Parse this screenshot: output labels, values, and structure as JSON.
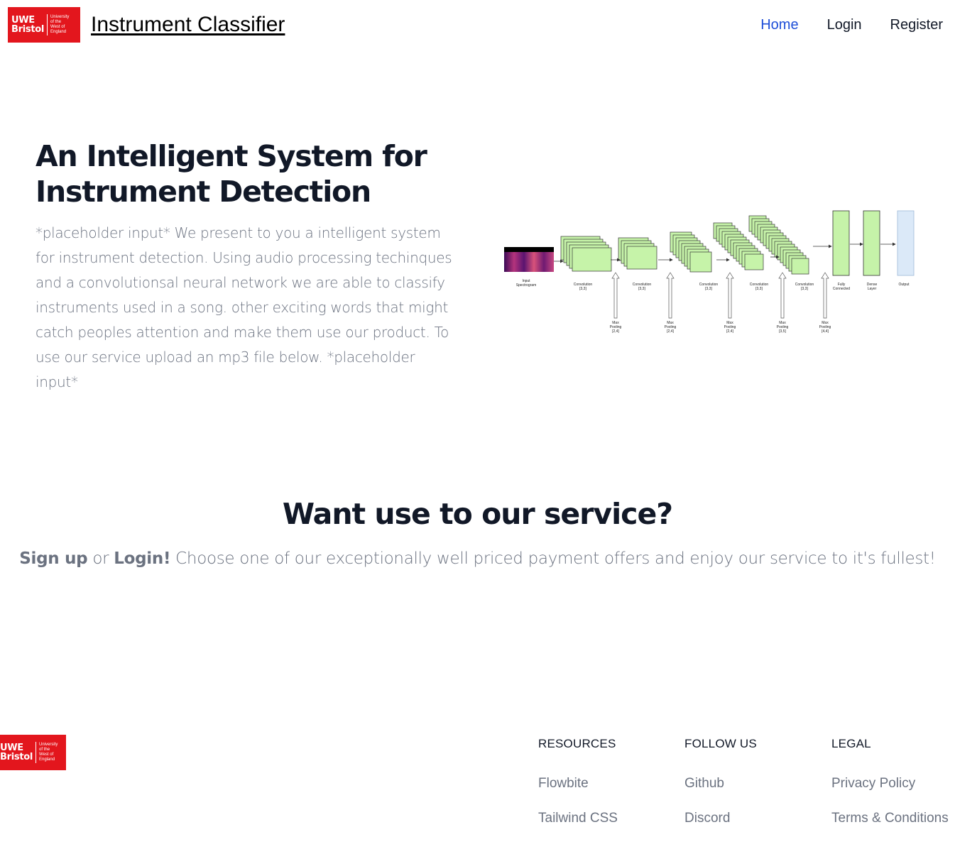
{
  "brand": {
    "logo_main": [
      "UWE",
      "Bristol"
    ],
    "logo_sub": [
      "University",
      "of the",
      "West of",
      "England"
    ],
    "logo_color": "#e3161d",
    "site_title": "Instrument Classifier"
  },
  "nav": {
    "items": [
      "Home",
      "Login",
      "Register"
    ],
    "active": "Home",
    "active_color": "#1d4ed8"
  },
  "hero": {
    "title_line1": "An Intelligent System for",
    "title_line2": "Instrument Detection",
    "text": "*placeholder input* We present to you a intelligent system for instrument detection. Using audio processing techinques and a convolutionsal neural network we are able to classify instruments used in a song. other exciting words that might catch peoples attention and make them use our product. To use our service upload an mp3 file below. *placeholder input*"
  },
  "diagram": {
    "labels": {
      "input": [
        "Input",
        "Spectrogram"
      ],
      "conv1": [
        "Convolution",
        "[3,3]"
      ],
      "conv2": [
        "Convolution",
        "[3,3]"
      ],
      "conv3": [
        "Convolution",
        "[3,3]"
      ],
      "conv4": [
        "Convolution",
        "[3,3]"
      ],
      "conv5": [
        "Convolution",
        "[3,3]"
      ],
      "fc": [
        "Fully",
        "Connected"
      ],
      "dense": [
        "Dense",
        "Layer"
      ],
      "output": [
        "Output"
      ],
      "pool1": [
        "Max",
        "Pooling",
        "[2,4]"
      ],
      "pool2": [
        "Max",
        "Pooling",
        "[2,4]"
      ],
      "pool3": [
        "Max",
        "Pooling",
        "[2,4]"
      ],
      "pool4": [
        "Max",
        "Pooling",
        "[3,5]"
      ],
      "pool5": [
        "Max",
        "Pooling",
        "[4,4]"
      ]
    },
    "layer_color": "#c6f3a9",
    "output_color": "#dbe9f8"
  },
  "cta": {
    "title": "Want use to our service?",
    "signup": "Sign up",
    "or": " or ",
    "login": "Login!",
    "rest": " Choose one of our exceptionally well priced payment offers and enjoy our service to it's fullest!"
  },
  "footer": {
    "resources": {
      "title": "RESOURCES",
      "links": [
        "Flowbite",
        "Tailwind CSS"
      ]
    },
    "follow": {
      "title": "FOLLOW US",
      "links": [
        "Github",
        "Discord"
      ]
    },
    "legal": {
      "title": "LEGAL",
      "links": [
        "Privacy Policy",
        "Terms & Conditions"
      ]
    }
  }
}
